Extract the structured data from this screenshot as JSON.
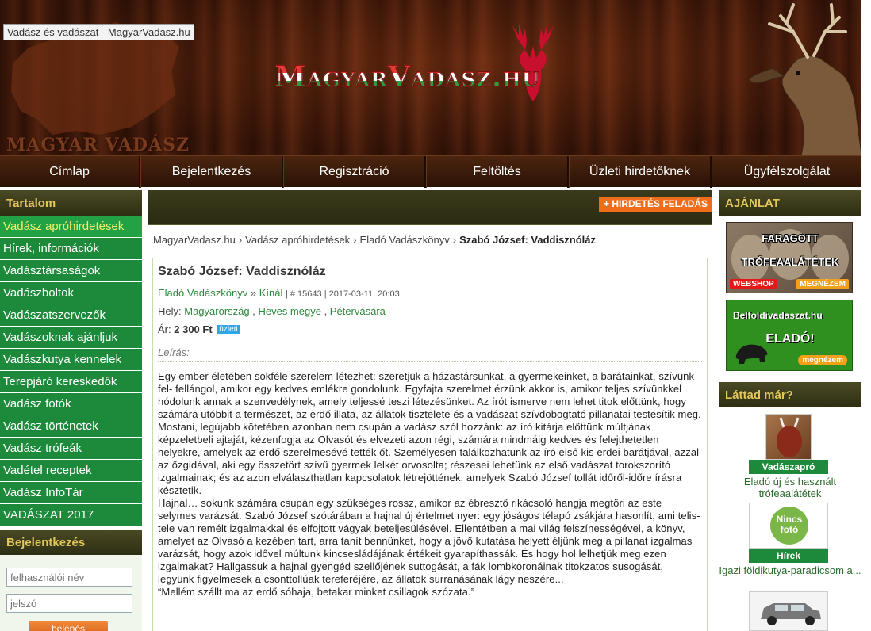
{
  "browser": {
    "tooltip": "Vadász és vadászat - MagyarVadasz.hu"
  },
  "header": {
    "brand_small": "MAGYAR VADÁSZ",
    "logo_text": "MagyarVadasz.hu",
    "colors": {
      "wood_dark": "#3a1508",
      "logo_red": "#e43a34",
      "logo_green": "#2f9a3f"
    }
  },
  "nav": [
    {
      "label": "Címlap"
    },
    {
      "label": "Bejelentkezés"
    },
    {
      "label": "Regisztráció"
    },
    {
      "label": "Feltöltés"
    },
    {
      "label": "Üzleti hirdetőknek"
    },
    {
      "label": "Ügyfélszolgálat"
    }
  ],
  "left": {
    "heading": "Tartalom",
    "menu": [
      "Vadász apróhirdetések",
      "Hírek, információk",
      "Vadásztársaságok",
      "Vadászboltok",
      "Vadászatszervezők",
      "Vadászoknak ajánljuk",
      "Vadászkutya kennelek",
      "Terepjáró kereskedők",
      "Vadász fotók",
      "Vadász történetek",
      "Vadász trófeák",
      "Vadétel receptek",
      "Vadász InfoTár",
      "VADÁSZAT 2017"
    ],
    "login": {
      "heading": "Bejelentkezés",
      "username_placeholder": "felhasználói név",
      "password_placeholder": "jelszó",
      "button": "belépés"
    }
  },
  "main": {
    "advert_button": "+ HIRDETÉS FELADÁS",
    "breadcrumb": [
      "MagyarVadasz.hu",
      "Vadász apróhirdetések",
      "Eladó Vadászkönyv",
      "Szabó József: Vaddisznóláz"
    ],
    "post": {
      "title": "Szabó József: Vaddisznóláz",
      "category": "Eladó Vadászkönyv",
      "arrow": "»",
      "type": "Kínál",
      "id_date": "| # 15643 | 2017-03-11. 20:03",
      "location_label": "Hely:",
      "location": [
        "Magyarország",
        "Heves megye",
        "Pétervására"
      ],
      "price_label": "Ár:",
      "price": "2 300 Ft",
      "price_badge": "üzleti",
      "desc_label": "Leírás:",
      "paragraphs": [
        "Egy ember életében sokféle szerelem létezhet: szeretjük a házastársunkat, a gyermekeinket, a barátainkat, szívünk fel- fellángol, amikor egy kedves emlékre gondolunk. Egyfajta szerelmet érzünk akkor is, amikor teljes szívünkkel hódolunk annak a szenvedélynek, amely teljessé teszi létezésünket. Az írót ismerve nem lehet titok előttünk, hogy számára utóbbit a természet, az erdő illata, az állatok tisztelete és a vadászat szívdobogtató pillanatai testesítik meg. Mostani, legújabb kötetében azonban nem csupán a vadász szól hozzánk: az író kitárja előttünk múltjának képzeletbeli ajtaját, kézenfogja az Olvasót és elvezeti azon régi, számára mindmáig kedves és felejthetetlen helyekre, amelyek az erdő szerelmesévé tették őt. Személyesen találkozhatunk az író első kis erdei barátjával, azzal az őzgidával, aki egy összetört szívű gyermek lelkét orvosolta; részesei lehetünk az első vadászat torokszorító izgalmainak; és az azon elválaszthatlan kapcsolatok létrejöttének, amelyek Szabó József tollát időről-időre írásra késztetik.",
        "Hajnal… sokunk számára csupán egy szükséges rossz, amikor az ébresztő rikácsoló hangja megtöri az este selymes varázsát. Szabó József szótárában a hajnal új értelmet nyer: egy jóságos télapó zsákjára hasonlít, ami telis-tele van remélt izgalmakkal és elfojtott vágyak beteljesülésével. Ellentétben a mai világ felszínességével, a könyv, amelyet az Olvasó a kezében tart, arra tanít bennünket, hogy a jövő kutatása helyett éljünk meg a pillanat izgalmas varázsát, hogy azok idővel múltunk kincsesládájának értékeit gyarapíthassák. És hogy hol lelhetjük meg ezen izgalmakat? Hallgassuk a hajnal gyengéd szellőjének suttogását, a fák lombkoronáinak titokzatos susogását, legyünk figyelmesek a csonttollúak tereferéjére, az állatok surranásának lágy neszére..."
      ],
      "quote": "“Mellém szállt ma az erdő sóhaja, betakar minket csillagok szózata.”"
    }
  },
  "right": {
    "heading": "AJÁNLAT",
    "ad1": {
      "line1": "FARAGOTT",
      "line2": "TRÓFEAALÁTÉTEK",
      "left_pill": "WEBSHOP",
      "right_pill": "MEGNÉZEM"
    },
    "ad2": {
      "line1": "Belfoldivadaszat.hu",
      "line2": "ELADÓ!",
      "pill": "megnézem"
    },
    "seen_heading": "Láttad már?",
    "items": [
      {
        "tag": "Vadászapró",
        "caption": "Eladó új és használt trófeaalátétek"
      },
      {
        "tag": "Hírek",
        "no_photo": "Nincs fotó",
        "caption": "Igazi földikutya-paradicsom a..."
      }
    ]
  }
}
